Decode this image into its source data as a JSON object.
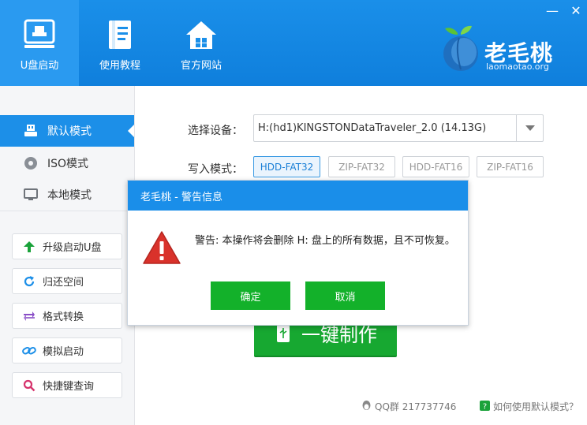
{
  "nav": {
    "items": [
      {
        "label": "U盘启动",
        "icon": "usb-drive-icon",
        "active": true
      },
      {
        "label": "使用教程",
        "icon": "book-icon",
        "active": false
      },
      {
        "label": "官方网站",
        "icon": "home-icon",
        "active": false
      }
    ]
  },
  "window": {
    "minimize": "—",
    "close": "✕"
  },
  "brand": {
    "name": "老毛桃",
    "domain": "laomaotao.org"
  },
  "sidebar": {
    "modes": [
      {
        "label": "默认模式",
        "icon": "usb-icon",
        "active": true
      },
      {
        "label": "ISO模式",
        "icon": "disc-icon",
        "active": false
      },
      {
        "label": "本地模式",
        "icon": "monitor-icon",
        "active": false
      }
    ],
    "tools": [
      {
        "label": "升级启动U盘",
        "icon": "arrow-up-icon"
      },
      {
        "label": "归还空间",
        "icon": "refresh-icon"
      },
      {
        "label": "格式转换",
        "icon": "swap-icon"
      },
      {
        "label": "模拟启动",
        "icon": "link-icon"
      },
      {
        "label": "快捷键查询",
        "icon": "search-icon"
      }
    ]
  },
  "main": {
    "device_label": "选择设备：",
    "device_value": "H:(hd1)KINGSTONDataTraveler_2.0 (14.13G)",
    "write_mode_label": "写入模式：",
    "write_modes": [
      {
        "label": "HDD-FAT32",
        "active": true
      },
      {
        "label": "ZIP-FAT32",
        "active": false
      },
      {
        "label": "HDD-FAT16",
        "active": false
      },
      {
        "label": "ZIP-FAT16",
        "active": false
      }
    ],
    "make_button": "一键制作",
    "qq": "QQ群 217737746",
    "help": "如何使用默认模式？"
  },
  "dialog": {
    "title": "老毛桃 - 警告信息",
    "message": "警告: 本操作将会删除 H: 盘上的所有数据，且不可恢复。",
    "ok": "确定",
    "cancel": "取消"
  },
  "colors": {
    "header_blue": "#1a8fe9",
    "active_blue": "#1c8fe8",
    "green": "#17a831",
    "warning_red": "#d9322b"
  }
}
